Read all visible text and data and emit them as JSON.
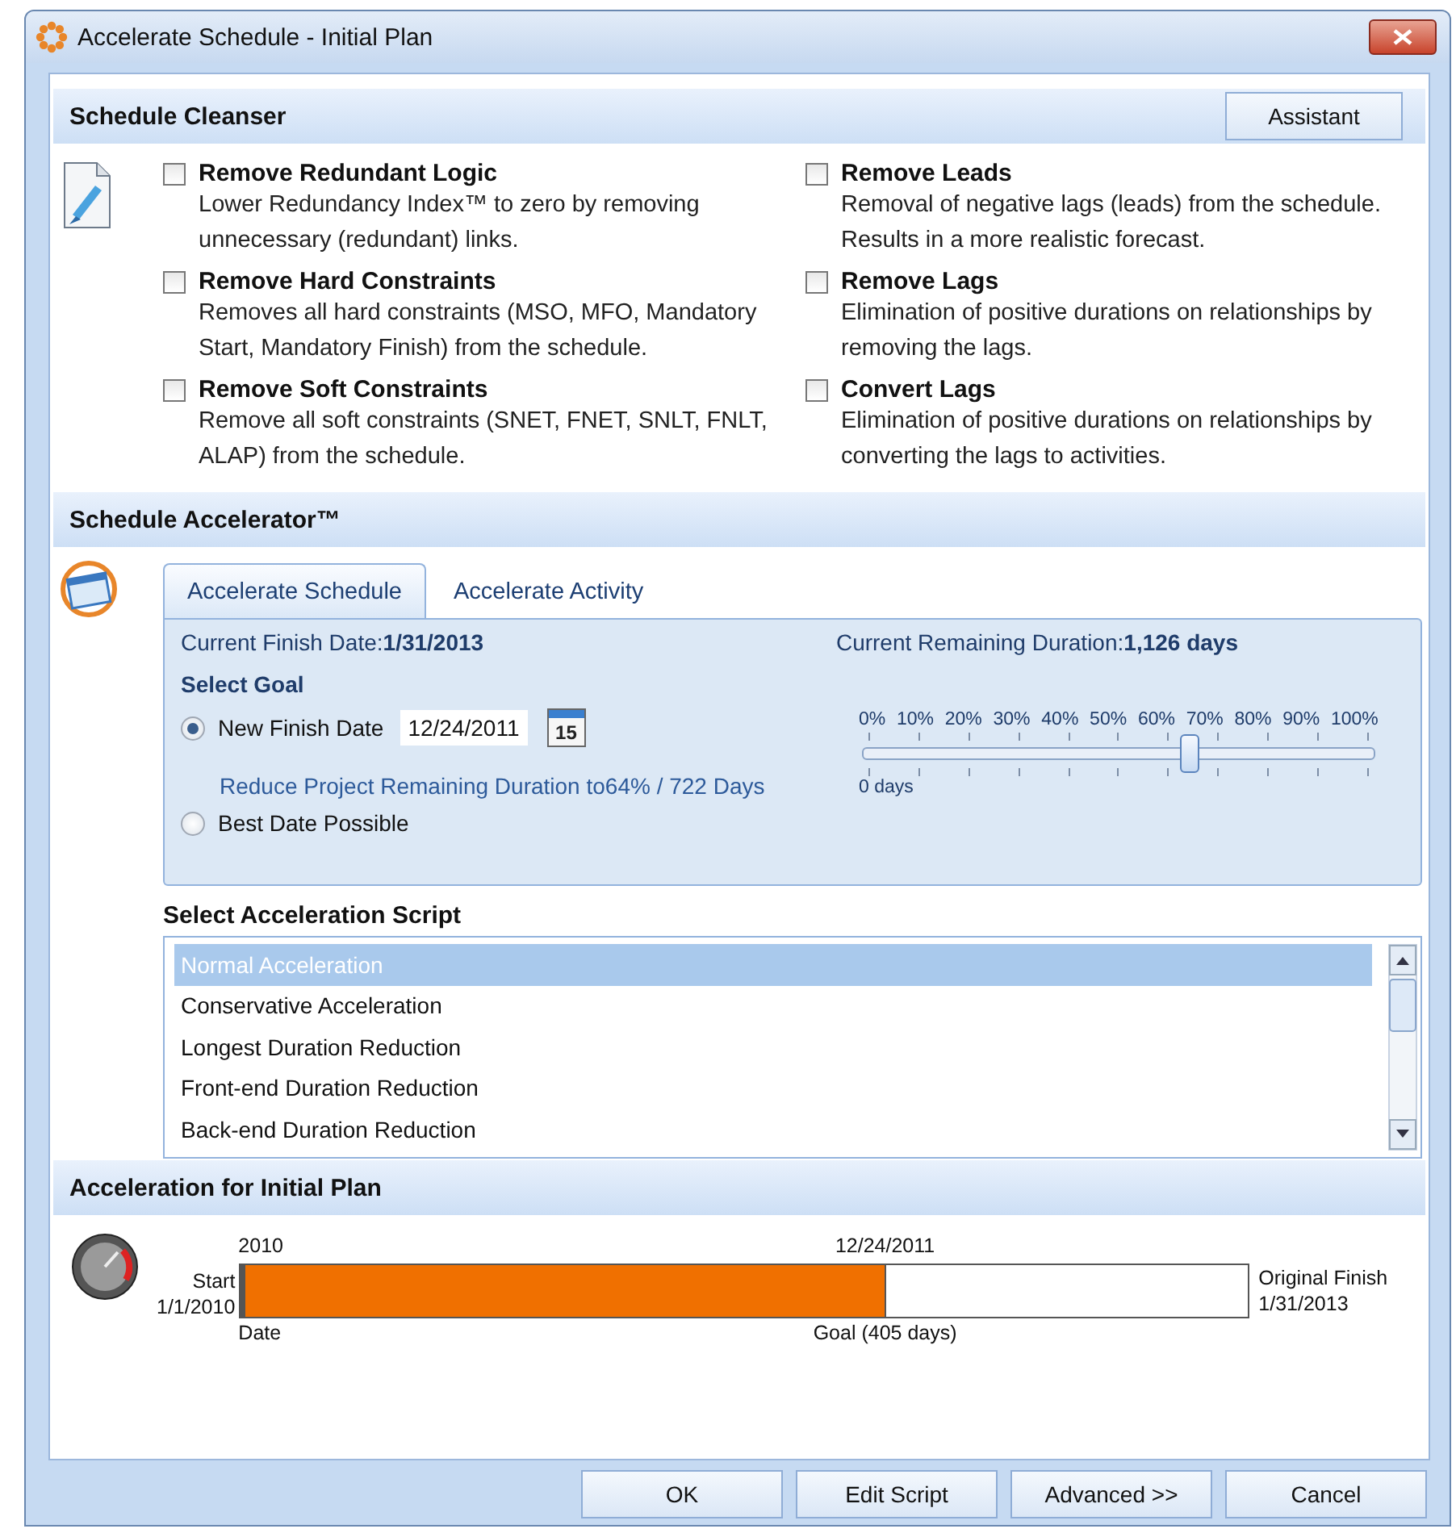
{
  "window": {
    "title": "Accelerate Schedule - Initial  Plan"
  },
  "cleanser": {
    "title": "Schedule Cleanser",
    "assistant_button": "Assistant",
    "left": [
      {
        "label": "Remove Redundant Logic",
        "description": "Lower Redundancy Index™ to zero by removing unnecessary (redundant) links.",
        "checked": false
      },
      {
        "label": "Remove Hard Constraints",
        "description": "Removes all hard constraints (MSO, MFO, Mandatory Start, Mandatory Finish) from the schedule.",
        "checked": false
      },
      {
        "label": "Remove Soft Constraints",
        "description": "Remove all soft constraints (SNET, FNET, SNLT, FNLT, ALAP) from the schedule.",
        "checked": false
      }
    ],
    "right": [
      {
        "label": "Remove Leads",
        "description": "Removal of negative lags (leads) from the schedule. Results in a more realistic forecast.",
        "checked": false
      },
      {
        "label": "Remove Lags",
        "description": "Elimination of positive durations on relationships by removing the lags.",
        "checked": false
      },
      {
        "label": "Convert Lags",
        "description": "Elimination of positive durations on relationships by converting the lags to activities.",
        "checked": false
      }
    ]
  },
  "accelerator": {
    "title": "Schedule Accelerator™",
    "tabs": [
      {
        "label": "Accelerate Schedule",
        "selected": true
      },
      {
        "label": "Accelerate Activity",
        "selected": false
      }
    ],
    "current_finish": {
      "label": "Current Finish Date:",
      "value": "1/31/2013"
    },
    "current_remaining": {
      "label": "Current Remaining Duration:",
      "value": "1,126 days"
    },
    "goal_heading": "Select Goal",
    "options": [
      {
        "label": "New Finish Date",
        "selected": true,
        "date": "12/24/2011",
        "calendar": "15"
      },
      {
        "label": "Best Date Possible",
        "selected": false
      }
    ],
    "reduce_text": "Reduce Project Remaining Duration to64% / 722 Days",
    "slider": {
      "ticks": [
        "0%",
        "10%",
        "20%",
        "30%",
        "40%",
        "50%",
        "60%",
        "70%",
        "80%",
        "90%",
        "100%"
      ],
      "level": 0.64,
      "min_label": "0 days"
    },
    "script_heading": "Select Acceleration Script",
    "scripts": [
      {
        "label": "Normal Acceleration",
        "selected": true
      },
      {
        "label": "Conservative Acceleration",
        "selected": false
      },
      {
        "label": "Longest Duration Reduction",
        "selected": false
      },
      {
        "label": "Front-end Duration Reduction",
        "selected": false
      },
      {
        "label": "Back-end Duration Reduction",
        "selected": false
      }
    ]
  },
  "summary": {
    "title": "Acceleration for Initial  Plan",
    "start_year": "2010",
    "goal_date": "12/24/2011",
    "start_label": "Start",
    "start_date": "1/1/2010",
    "finish_label": "Original Finish",
    "finish_date": "1/31/2013",
    "date_label": "Date",
    "goal_label": "Goal (405 days)",
    "level": 0.64
  },
  "buttons": [
    "OK",
    "Edit Script",
    "Advanced >>",
    "Cancel"
  ]
}
